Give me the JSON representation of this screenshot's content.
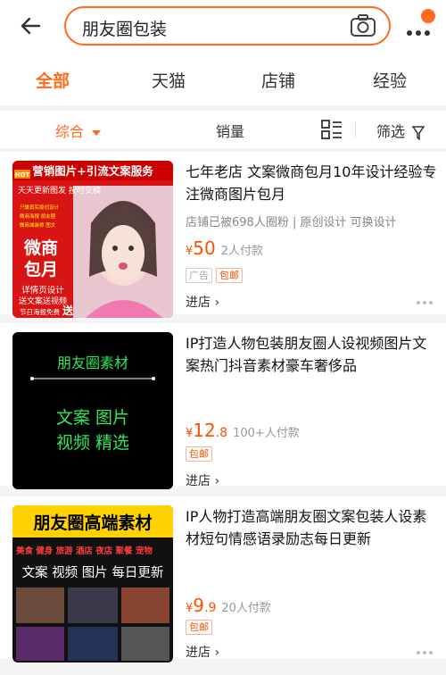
{
  "search": {
    "query": "朋友圈包装"
  },
  "tabs": [
    "全部",
    "天猫",
    "店铺",
    "经验"
  ],
  "filters": {
    "sort": "综合",
    "sales": "销量",
    "filter": "筛选"
  },
  "products": [
    {
      "title": "七年老店 文案微商包月10年设计经验专注微商图片包月",
      "meta": "店铺已被698人圈粉 | 原创设计 可换设计",
      "price_int": "50",
      "price_dec": "",
      "buyers": "2人付款",
      "tags": [
        "广告",
        "包邮"
      ],
      "store": "进店 ›",
      "thumb_text": {
        "top": "营销图片+引流文案服务",
        "sub": "天天更新图发 按时交稿",
        "big1": "微商",
        "big2": "包月",
        "line1": "详情页设计",
        "line2": "送文案送视频",
        "foot1": "节日海报免费",
        "foot2": "送",
        "hot": "HOT"
      }
    },
    {
      "title": "IP打造人物包装朋友圈人设视频图片文案热门抖音素材豪车奢侈品",
      "price_int": "12",
      "price_dec": ".8",
      "buyers": "100+人付款",
      "tags": [
        "包邮"
      ],
      "store": "进店 ›",
      "thumb_text": {
        "t1": "朋友圈素材",
        "t2": "文案 图片",
        "t3": "视频 精选"
      }
    },
    {
      "title": "IP人物打造高端朋友圈文案包装人设素材短句情感语录励志每日更新",
      "price_int": "9",
      "price_dec": ".9",
      "buyers": "20人付款",
      "tags": [
        "包邮"
      ],
      "store": "进店 ›",
      "thumb_text": {
        "t1": "朋友圈高端素材",
        "t2": "美食 健身 旅游 酒店 夜店 聚餐 宠物",
        "t3": "文案 视频 图片 每日更新"
      }
    }
  ],
  "colors": {
    "accent": "#ff6a1c",
    "price": "#ff5000"
  }
}
